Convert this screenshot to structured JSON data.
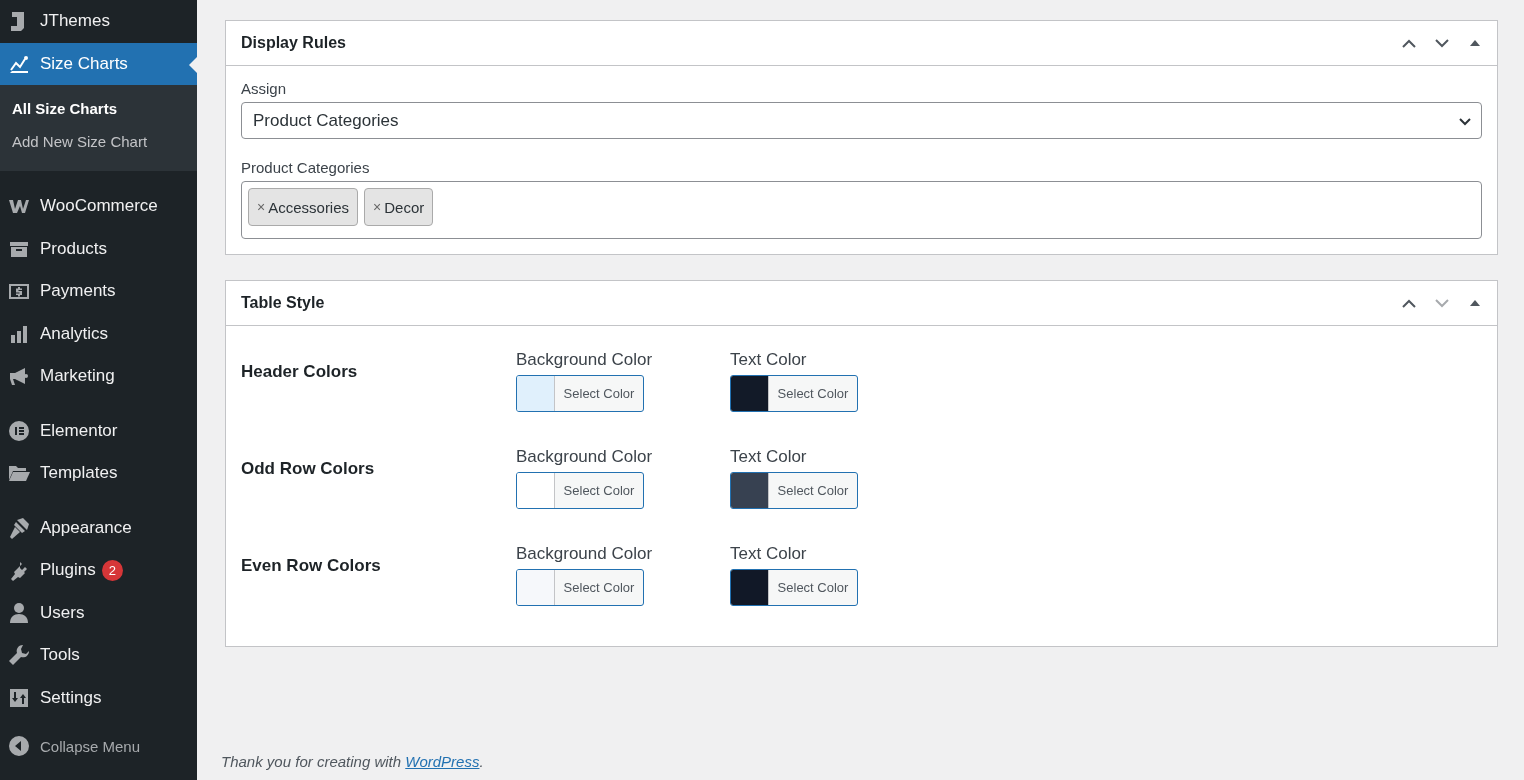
{
  "sidebar": {
    "groups": [
      {
        "items": [
          {
            "label": "JThemes",
            "selected": false
          },
          {
            "label": "Size Charts",
            "selected": true,
            "submenu": [
              {
                "label": "All Size Charts",
                "selected": true
              },
              {
                "label": "Add New Size Chart",
                "selected": false
              }
            ]
          }
        ]
      },
      {
        "items": [
          {
            "label": "WooCommerce",
            "selected": false
          },
          {
            "label": "Products",
            "selected": false
          },
          {
            "label": "Payments",
            "selected": false
          },
          {
            "label": "Analytics",
            "selected": false
          },
          {
            "label": "Marketing",
            "selected": false
          }
        ]
      },
      {
        "items": [
          {
            "label": "Elementor",
            "selected": false
          },
          {
            "label": "Templates",
            "selected": false
          }
        ]
      },
      {
        "items": [
          {
            "label": "Appearance",
            "selected": false
          },
          {
            "label": "Plugins",
            "selected": false,
            "badge": "2"
          },
          {
            "label": "Users",
            "selected": false
          },
          {
            "label": "Tools",
            "selected": false
          },
          {
            "label": "Settings",
            "selected": false
          }
        ]
      }
    ],
    "collapse": "Collapse Menu"
  },
  "display_rules": {
    "title": "Display Rules",
    "actions": [
      {
        "kind": "up",
        "disabled": false
      },
      {
        "kind": "down",
        "disabled": false
      },
      {
        "kind": "toggle",
        "disabled": false
      }
    ],
    "assign_label": "Assign",
    "assign_value": "Product Categories",
    "categories_label": "Product Categories",
    "tags": [
      {
        "remove": "×",
        "label": "Accessories"
      },
      {
        "remove": "×",
        "label": "Decor"
      }
    ]
  },
  "table_style": {
    "title": "Table Style",
    "actions": [
      {
        "kind": "up",
        "disabled": false
      },
      {
        "kind": "down",
        "disabled": true
      },
      {
        "kind": "toggle",
        "disabled": false
      }
    ],
    "rows": [
      {
        "label": "Header Colors",
        "pickers": [
          {
            "label": "Background Color",
            "button": "Select Color",
            "color": "#e0f0fc"
          },
          {
            "label": "Text Color",
            "button": "Select Color",
            "color": "#121a28"
          }
        ]
      },
      {
        "label": "Odd Row Colors",
        "pickers": [
          {
            "label": "Background Color",
            "button": "Select Color",
            "color": "#ffffff"
          },
          {
            "label": "Text Color",
            "button": "Select Color",
            "color": "#374151"
          }
        ]
      },
      {
        "label": "Even Row Colors",
        "pickers": [
          {
            "label": "Background Color",
            "button": "Select Color",
            "color": "#f6f8fb"
          },
          {
            "label": "Text Color",
            "button": "Select Color",
            "color": "#111827"
          }
        ]
      }
    ]
  },
  "footer": {
    "text": "Thank you for creating with ",
    "link": "WordPress",
    "end": "."
  }
}
